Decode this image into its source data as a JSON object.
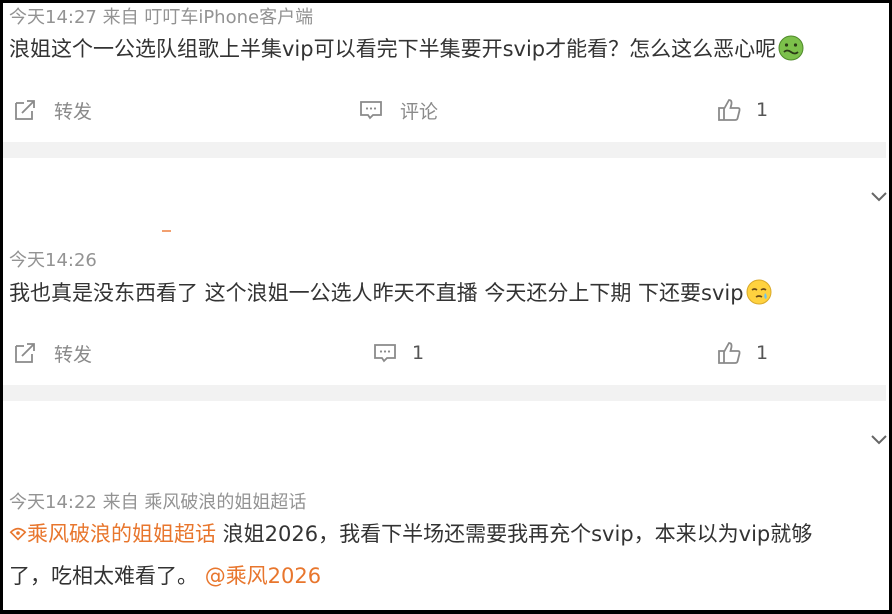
{
  "posts": [
    {
      "meta": "今天14:27  来自 叮叮车iPhone客户端",
      "text": "浪姐这个一公选队组歌上半集vip可以看完下半集要开svip才能看？怎么这么恶心呢",
      "emoji": "nauseated-face-emoji",
      "actions": {
        "repost": "转发",
        "comment": "评论",
        "like_count": "1"
      }
    },
    {
      "meta": "今天14:26",
      "text": "我也真是没东西看了 这个浪姐一公选人昨天不直播 今天还分上下期 下还要svip",
      "emoji": "sleepy-face-emoji",
      "actions": {
        "repost": "转发",
        "comment_count": "1",
        "like_count": "1"
      }
    },
    {
      "meta": "今天14:22  来自 乘风破浪的姐姐超话",
      "topic": "乘风破浪的姐姐超话",
      "text_line1": " 浪姐2026，我看下半场还需要我再充个svip，本来以为vip就够",
      "text_line2": "了，吃相太难看了。 ",
      "mention": "@乘风2026"
    }
  ],
  "colors": {
    "accent": "#e8762d",
    "meta": "#939393",
    "separator": "#f2f2f2"
  }
}
